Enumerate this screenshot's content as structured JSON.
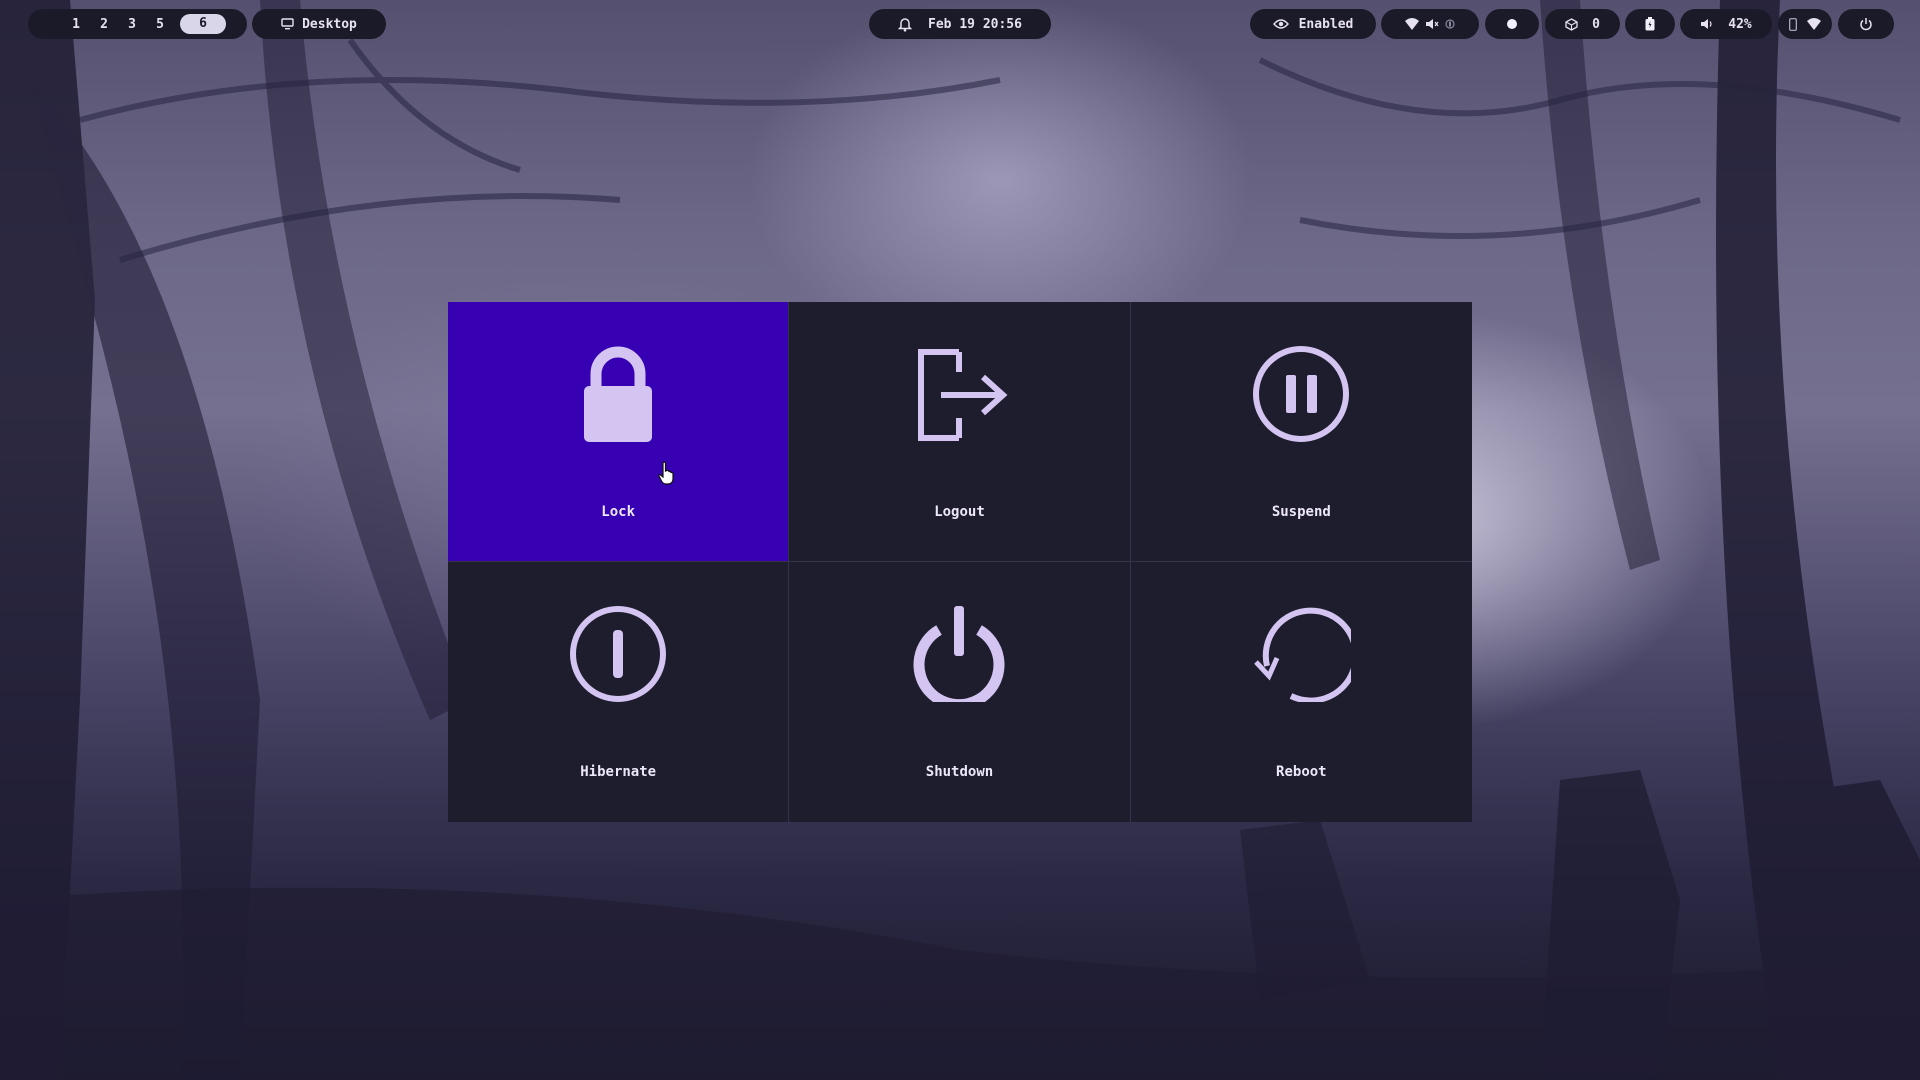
{
  "workspaces": {
    "items": [
      "1",
      "2",
      "3",
      "5"
    ],
    "active": "6"
  },
  "desktop_label": "Desktop",
  "clock": "Feb 19 20:56",
  "idle_inhibitor": "Enabled",
  "updates_count": "0",
  "volume": "42%",
  "power_menu": {
    "options": [
      {
        "label": "Lock",
        "icon": "lock-icon",
        "selected": true
      },
      {
        "label": "Logout",
        "icon": "logout-icon",
        "selected": false
      },
      {
        "label": "Suspend",
        "icon": "suspend-icon",
        "selected": false
      },
      {
        "label": "Hibernate",
        "icon": "hibernate-icon",
        "selected": false
      },
      {
        "label": "Shutdown",
        "icon": "shutdown-icon",
        "selected": false
      },
      {
        "label": "Reboot",
        "icon": "reboot-icon",
        "selected": false
      }
    ]
  },
  "colors": {
    "selected_tile": "#3700b3",
    "tile_background": "#1e1d2d",
    "icon_color": "#d4c4f2",
    "bar_pill": "#1a1a28"
  }
}
